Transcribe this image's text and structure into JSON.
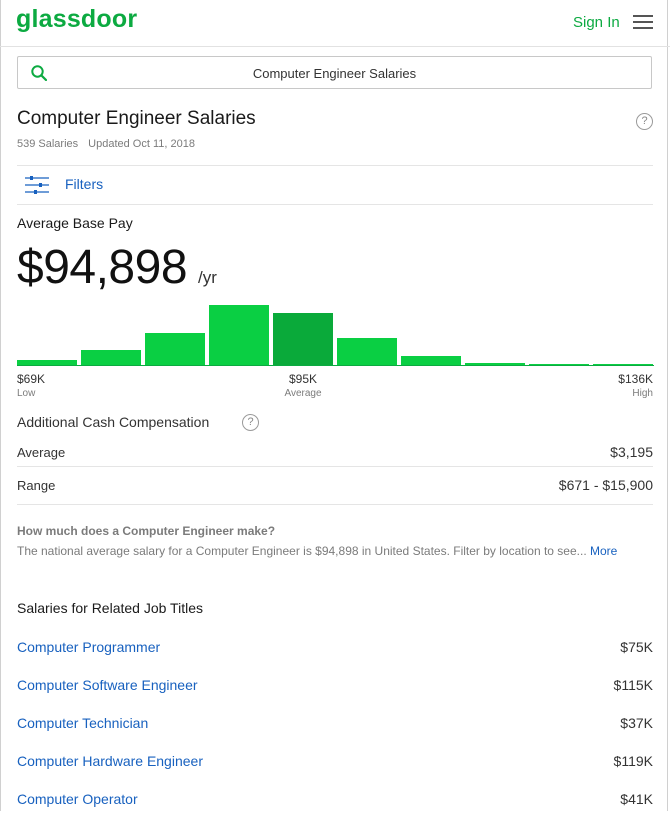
{
  "header": {
    "logo": "glassdoor",
    "sign_in": "Sign In"
  },
  "search": {
    "value": "Computer Engineer Salaries"
  },
  "page": {
    "title": "Computer Engineer Salaries",
    "salary_count": "539 Salaries",
    "updated": "Updated Oct 11, 2018",
    "help_glyph": "?"
  },
  "filters": {
    "label": "Filters"
  },
  "base_pay": {
    "label": "Average Base Pay",
    "value": "$94,898",
    "unit": "/yr",
    "histogram_relative_heights": [
      0.1,
      0.25,
      0.53,
      0.98,
      0.85,
      0.45,
      0.16,
      0.05,
      0.04,
      0.02
    ],
    "bar_colors": {
      "default": "#0acf43",
      "highlight": "#0aaa3a"
    },
    "highlight_index": 4,
    "axis": {
      "low_value": "$69K",
      "low_label": "Low",
      "avg_value": "$95K",
      "avg_label": "Average",
      "high_value": "$136K",
      "high_label": "High"
    }
  },
  "additional_cash": {
    "label": "Additional Cash Compensation",
    "average_label": "Average",
    "average_value": "$3,195",
    "range_label": "Range",
    "range_value": "$671 - $15,900"
  },
  "faq": {
    "question": "How much does a Computer Engineer make?",
    "answer": "The national average salary for a Computer Engineer is $94,898 in United States. Filter by location to see...",
    "more": "More"
  },
  "related": {
    "title": "Salaries for Related Job Titles",
    "jobs": [
      {
        "title": "Computer Programmer",
        "pay": "$75K"
      },
      {
        "title": "Computer Software Engineer",
        "pay": "$115K"
      },
      {
        "title": "Computer Technician",
        "pay": "$37K"
      },
      {
        "title": "Computer Hardware Engineer",
        "pay": "$119K"
      },
      {
        "title": "Computer Operator",
        "pay": "$41K"
      }
    ]
  },
  "colors": {
    "brand_green": "#0caa41",
    "link_blue": "#1861bf"
  }
}
